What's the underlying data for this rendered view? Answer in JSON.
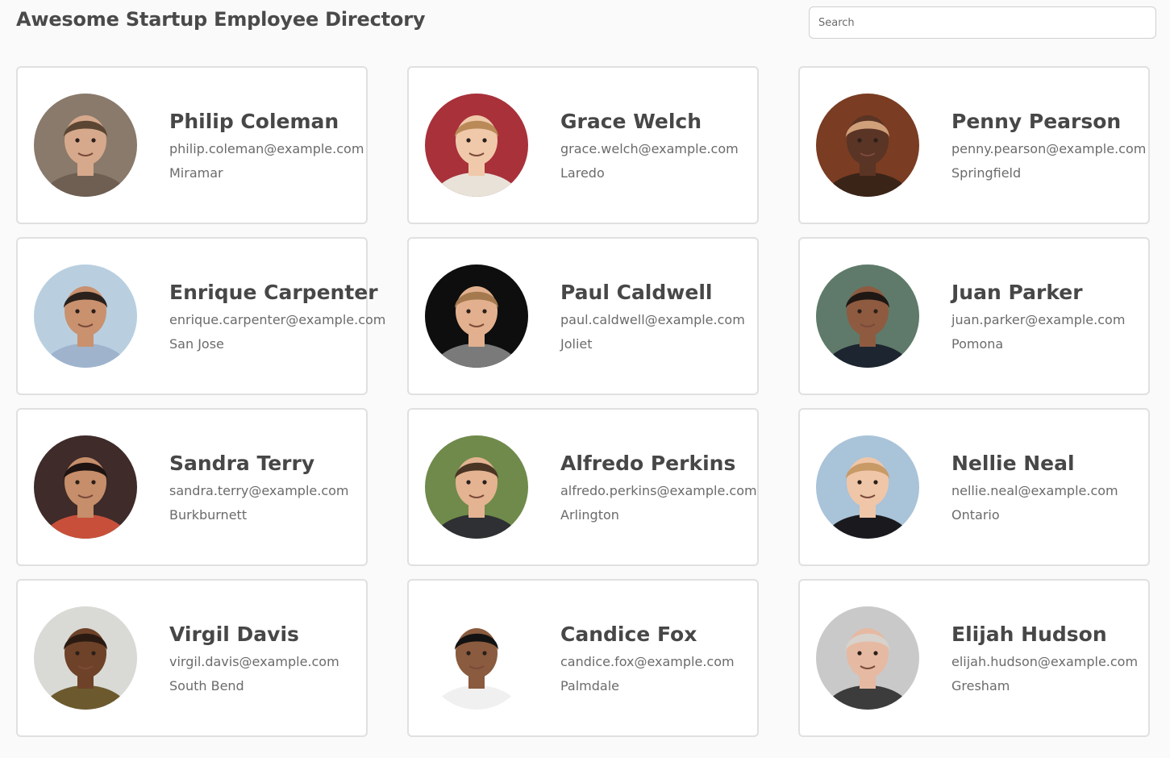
{
  "header": {
    "title": "Awesome Startup Employee Directory",
    "search_placeholder": "Search",
    "search_value": ""
  },
  "employees": [
    {
      "name": "Philip Coleman",
      "email": "philip.coleman@example.com",
      "city": "Miramar",
      "avatar": {
        "bg": "#8a7a6c",
        "skin": "#d6a98c",
        "hair": "#5a4632",
        "shirt": "#6e5f52"
      }
    },
    {
      "name": "Grace Welch",
      "email": "grace.welch@example.com",
      "city": "Laredo",
      "avatar": {
        "bg": "#a8313a",
        "skin": "#f0c9aa",
        "hair": "#b98a58",
        "shirt": "#e8e2d8"
      }
    },
    {
      "name": "Penny Pearson",
      "email": "penny.pearson@example.com",
      "city": "Springfield",
      "avatar": {
        "bg": "#7a3c22",
        "skin": "#5a3424",
        "hair": "#d0a07a",
        "shirt": "#3a2418"
      }
    },
    {
      "name": "Enrique Carpenter",
      "email": "enrique.carpenter@example.com",
      "city": "San Jose",
      "avatar": {
        "bg": "#b9cfe0",
        "skin": "#c9916e",
        "hair": "#2a211c",
        "shirt": "#9fb4cc"
      }
    },
    {
      "name": "Paul Caldwell",
      "email": "paul.caldwell@example.com",
      "city": "Joliet",
      "avatar": {
        "bg": "#0e0e0e",
        "skin": "#e2b08e",
        "hair": "#a5794e",
        "shirt": "#7a7a7a"
      }
    },
    {
      "name": "Juan Parker",
      "email": "juan.parker@example.com",
      "city": "Pomona",
      "avatar": {
        "bg": "#5f7a6a",
        "skin": "#8e5b40",
        "hair": "#1f1714",
        "shirt": "#1c2530"
      }
    },
    {
      "name": "Sandra Terry",
      "email": "sandra.terry@example.com",
      "city": "Burkburnett",
      "avatar": {
        "bg": "#3e2b2a",
        "skin": "#c68e6a",
        "hair": "#1e1412",
        "shirt": "#c8503a"
      }
    },
    {
      "name": "Alfredo Perkins",
      "email": "alfredo.perkins@example.com",
      "city": "Arlington",
      "avatar": {
        "bg": "#6f8a4a",
        "skin": "#e4b392",
        "hair": "#4a3524",
        "shirt": "#2e3033"
      }
    },
    {
      "name": "Nellie Neal",
      "email": "nellie.neal@example.com",
      "city": "Ontario",
      "avatar": {
        "bg": "#a9c3d9",
        "skin": "#efc6a8",
        "hair": "#c89a66",
        "shirt": "#1a1a1e"
      }
    },
    {
      "name": "Virgil Davis",
      "email": "virgil.davis@example.com",
      "city": "South Bend",
      "avatar": {
        "bg": "#d9dad6",
        "skin": "#6e4228",
        "hair": "#2a1a12",
        "shirt": "#6c5a2e"
      }
    },
    {
      "name": "Candice Fox",
      "email": "candice.fox@example.com",
      "city": "Palmdale",
      "avatar": {
        "bg": "#ffffff",
        "skin": "#8a5b3e",
        "hair": "#121212",
        "shirt": "#f0f0f0"
      }
    },
    {
      "name": "Elijah Hudson",
      "email": "elijah.hudson@example.com",
      "city": "Gresham",
      "avatar": {
        "bg": "#c9c9c9",
        "skin": "#e6b9a2",
        "hair": "#d8d2cc",
        "shirt": "#3c3c3c"
      }
    }
  ]
}
